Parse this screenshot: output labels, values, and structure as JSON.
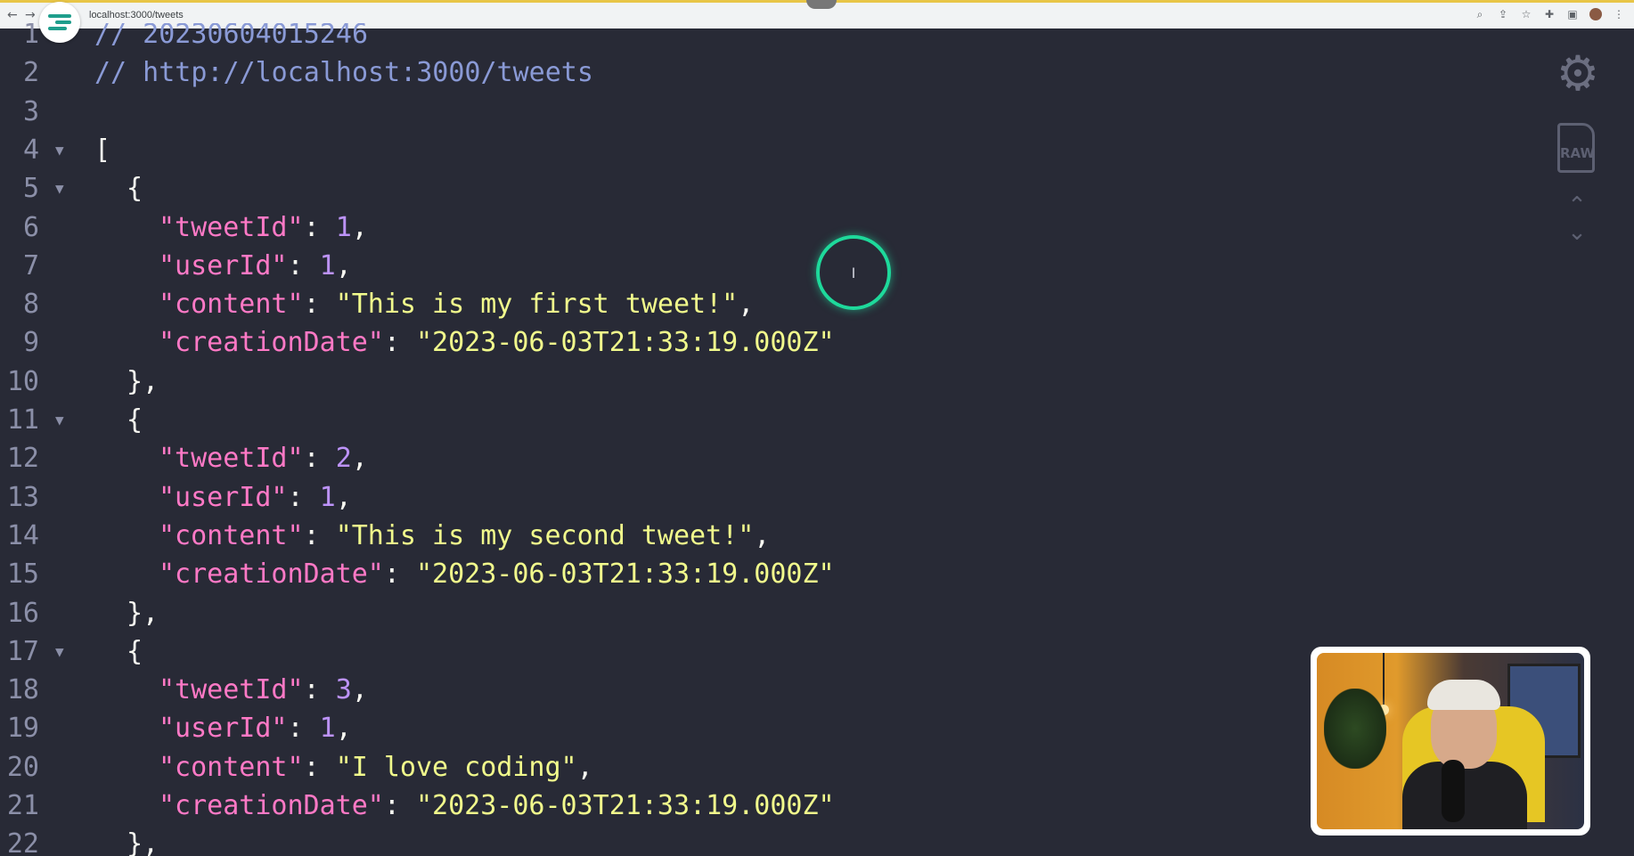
{
  "browser": {
    "url": "localhost:3000/tweets",
    "back_icon": "←",
    "forward_icon": "→"
  },
  "editor": {
    "lines": [
      {
        "n": "1",
        "fold": "",
        "indent": 0,
        "tokens": [
          [
            "cm",
            "// 20230604015246"
          ]
        ]
      },
      {
        "n": "2",
        "fold": "",
        "indent": 0,
        "tokens": [
          [
            "cm",
            "// http://localhost:3000/tweets"
          ]
        ]
      },
      {
        "n": "3",
        "fold": "",
        "indent": 0,
        "tokens": []
      },
      {
        "n": "4",
        "fold": "▼",
        "indent": 0,
        "tokens": [
          [
            "punc",
            "["
          ]
        ]
      },
      {
        "n": "5",
        "fold": "▼",
        "indent": 1,
        "tokens": [
          [
            "punc",
            "{"
          ]
        ]
      },
      {
        "n": "6",
        "fold": "",
        "indent": 2,
        "tokens": [
          [
            "key",
            "\"tweetId\""
          ],
          [
            "punc",
            ": "
          ],
          [
            "num",
            "1"
          ],
          [
            "punc",
            ","
          ]
        ]
      },
      {
        "n": "7",
        "fold": "",
        "indent": 2,
        "tokens": [
          [
            "key",
            "\"userId\""
          ],
          [
            "punc",
            ": "
          ],
          [
            "num",
            "1"
          ],
          [
            "punc",
            ","
          ]
        ]
      },
      {
        "n": "8",
        "fold": "",
        "indent": 2,
        "tokens": [
          [
            "key",
            "\"content\""
          ],
          [
            "punc",
            ": "
          ],
          [
            "str",
            "\"This is my first tweet!\""
          ],
          [
            "punc",
            ","
          ]
        ]
      },
      {
        "n": "9",
        "fold": "",
        "indent": 2,
        "tokens": [
          [
            "key",
            "\"creationDate\""
          ],
          [
            "punc",
            ": "
          ],
          [
            "str",
            "\"2023-06-03T21:33:19.000Z\""
          ]
        ]
      },
      {
        "n": "10",
        "fold": "",
        "indent": 1,
        "tokens": [
          [
            "punc",
            "},"
          ]
        ]
      },
      {
        "n": "11",
        "fold": "▼",
        "indent": 1,
        "tokens": [
          [
            "punc",
            "{"
          ]
        ]
      },
      {
        "n": "12",
        "fold": "",
        "indent": 2,
        "tokens": [
          [
            "key",
            "\"tweetId\""
          ],
          [
            "punc",
            ": "
          ],
          [
            "num",
            "2"
          ],
          [
            "punc",
            ","
          ]
        ]
      },
      {
        "n": "13",
        "fold": "",
        "indent": 2,
        "tokens": [
          [
            "key",
            "\"userId\""
          ],
          [
            "punc",
            ": "
          ],
          [
            "num",
            "1"
          ],
          [
            "punc",
            ","
          ]
        ]
      },
      {
        "n": "14",
        "fold": "",
        "indent": 2,
        "tokens": [
          [
            "key",
            "\"content\""
          ],
          [
            "punc",
            ": "
          ],
          [
            "str",
            "\"This is my second tweet!\""
          ],
          [
            "punc",
            ","
          ]
        ]
      },
      {
        "n": "15",
        "fold": "",
        "indent": 2,
        "tokens": [
          [
            "key",
            "\"creationDate\""
          ],
          [
            "punc",
            ": "
          ],
          [
            "str",
            "\"2023-06-03T21:33:19.000Z\""
          ]
        ]
      },
      {
        "n": "16",
        "fold": "",
        "indent": 1,
        "tokens": [
          [
            "punc",
            "},"
          ]
        ]
      },
      {
        "n": "17",
        "fold": "▼",
        "indent": 1,
        "tokens": [
          [
            "punc",
            "{"
          ]
        ]
      },
      {
        "n": "18",
        "fold": "",
        "indent": 2,
        "tokens": [
          [
            "key",
            "\"tweetId\""
          ],
          [
            "punc",
            ": "
          ],
          [
            "num",
            "3"
          ],
          [
            "punc",
            ","
          ]
        ]
      },
      {
        "n": "19",
        "fold": "",
        "indent": 2,
        "tokens": [
          [
            "key",
            "\"userId\""
          ],
          [
            "punc",
            ": "
          ],
          [
            "num",
            "1"
          ],
          [
            "punc",
            ","
          ]
        ]
      },
      {
        "n": "20",
        "fold": "",
        "indent": 2,
        "tokens": [
          [
            "key",
            "\"content\""
          ],
          [
            "punc",
            ": "
          ],
          [
            "str",
            "\"I love coding\""
          ],
          [
            "punc",
            ","
          ]
        ]
      },
      {
        "n": "21",
        "fold": "",
        "indent": 2,
        "tokens": [
          [
            "key",
            "\"creationDate\""
          ],
          [
            "punc",
            ": "
          ],
          [
            "str",
            "\"2023-06-03T21:33:19.000Z\""
          ]
        ]
      },
      {
        "n": "22",
        "fold": "",
        "indent": 1,
        "tokens": [
          [
            "punc",
            "},"
          ]
        ]
      }
    ]
  },
  "toolbar": {
    "settings_icon": "⚙",
    "raw_label": "RAW",
    "scroll_up_icon": "⌃",
    "scroll_down_icon": "⌄"
  },
  "cursor": {
    "glyph": "I"
  },
  "colors": {
    "background": "#282a36",
    "comment": "#8a9ad6",
    "key": "#ff79c6",
    "string": "#f1fa8c",
    "number": "#bd93f9",
    "cursor_ring": "#1ed99b"
  }
}
